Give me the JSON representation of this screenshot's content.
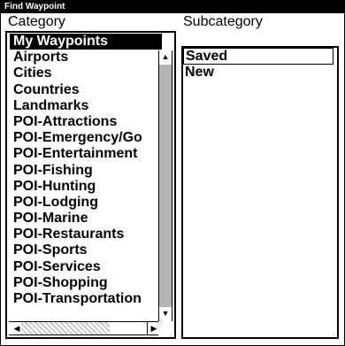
{
  "window": {
    "title": "Find Waypoint"
  },
  "headers": {
    "category": "Category",
    "subcategory": "Subcategory"
  },
  "category": {
    "selected_index": 0,
    "items": [
      "My Waypoints",
      "Airports",
      "Cities",
      "Countries",
      "Landmarks",
      "POI-Attractions",
      "POI-Emergency/Go",
      "POI-Entertainment",
      "POI-Fishing",
      "POI-Hunting",
      "POI-Lodging",
      "POI-Marine",
      "POI-Restaurants",
      "POI-Sports",
      "POI-Services",
      "POI-Shopping",
      "POI-Transportation"
    ],
    "icons": {
      "up": "arrow-up-icon",
      "down": "arrow-down-icon",
      "left": "arrow-left-icon",
      "right": "arrow-right-icon"
    },
    "glyphs": {
      "up": "▲",
      "down": "▼",
      "left": "◀",
      "right": "▶"
    }
  },
  "subcategory": {
    "items": [
      "Saved",
      "New"
    ]
  },
  "colors": {
    "selected_bg": "#000000",
    "selected_fg": "#ffffff"
  }
}
